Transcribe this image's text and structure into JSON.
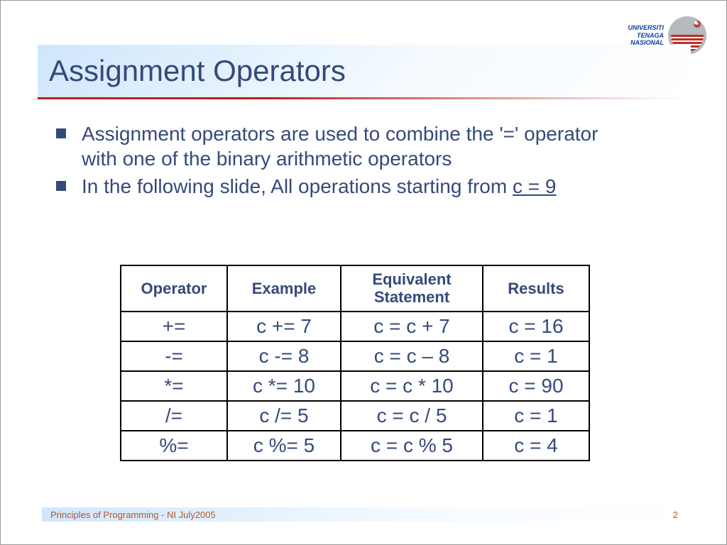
{
  "logo": {
    "line1": "UNIVERSITI",
    "line2": "TENAGA",
    "line3": "NASIONAL"
  },
  "title": "Assignment Operators",
  "bullets": {
    "b1": "Assignment operators are used to combine the '=' operator with one of the binary arithmetic operators",
    "b2_pre": "In the following slide, All operations starting from ",
    "b2_under": "c = 9"
  },
  "table": {
    "headers": {
      "h1": "Operator",
      "h2": "Example",
      "h3": "Equivalent Statement",
      "h4": "Results"
    },
    "rows": [
      {
        "op": "+=",
        "ex": "c += 7",
        "eq": "c = c + 7",
        "res": "c = 16"
      },
      {
        "op": "-=",
        "ex": "c -= 8",
        "eq": "c = c – 8",
        "res": "c = 1"
      },
      {
        "op": "*=",
        "ex": "c *= 10",
        "eq": "c = c * 10",
        "res": "c = 90"
      },
      {
        "op": "/=",
        "ex": "c /= 5",
        "eq": "c = c / 5",
        "res": "c = 1"
      },
      {
        "op": "%=",
        "ex": "c %= 5",
        "eq": "c = c % 5",
        "res": "c = 4"
      }
    ]
  },
  "footer": {
    "text": "Principles of Programming - NI July2005",
    "page": "2"
  },
  "chart_data": {
    "type": "table",
    "title": "Assignment Operators",
    "initial": "c = 9",
    "columns": [
      "Operator",
      "Example",
      "Equivalent Statement",
      "Results"
    ],
    "rows": [
      [
        "+=",
        "c += 7",
        "c = c + 7",
        "c = 16"
      ],
      [
        "-=",
        "c -= 8",
        "c = c - 8",
        "c = 1"
      ],
      [
        "*=",
        "c *= 10",
        "c = c * 10",
        "c = 90"
      ],
      [
        "/=",
        "c /= 5",
        "c = c / 5",
        "c = 1"
      ],
      [
        "%=",
        "c %= 5",
        "c = c % 5",
        "c = 4"
      ]
    ]
  }
}
